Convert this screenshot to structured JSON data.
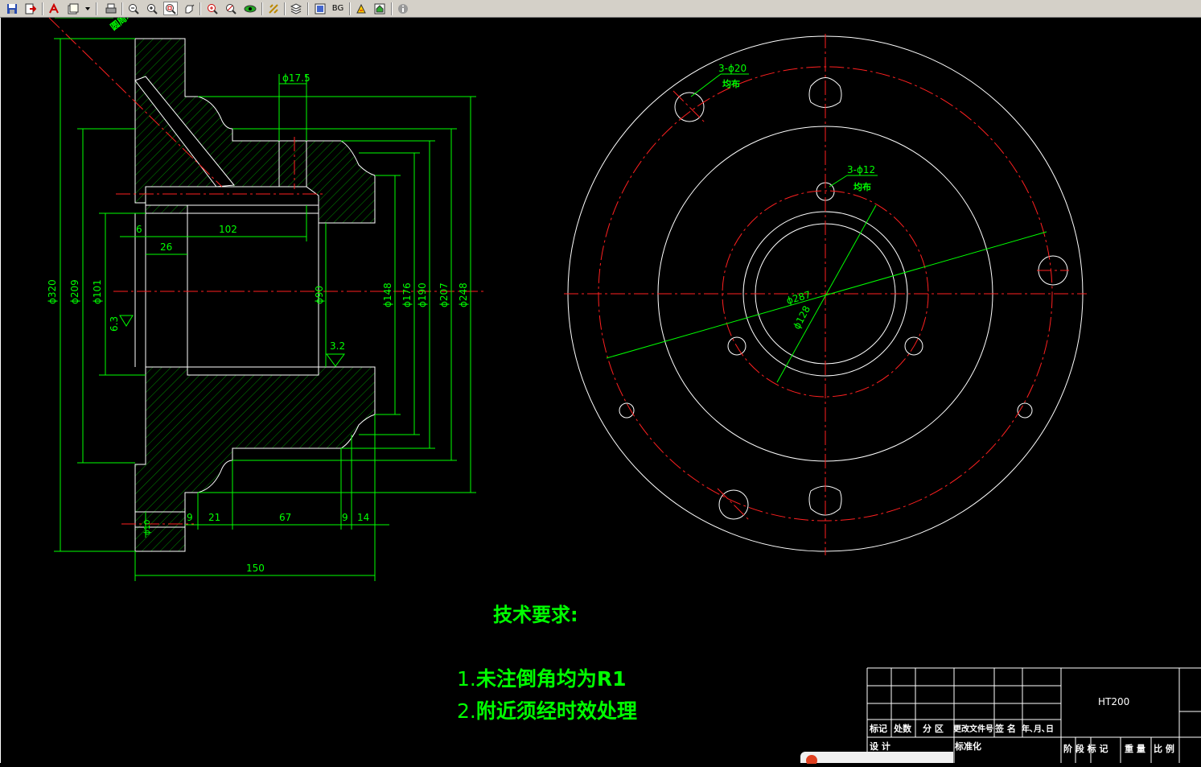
{
  "toolbar": {
    "buttons": [
      {
        "name": "save-icon",
        "glyph": "▣"
      },
      {
        "name": "export-icon",
        "glyph": "⇥"
      },
      {
        "name": "pdf-icon",
        "glyph": "✂"
      },
      {
        "name": "print-setup-icon",
        "glyph": "▤"
      },
      {
        "name": "dropdown-icon",
        "glyph": "▾"
      },
      {
        "name": "print-icon",
        "glyph": "⎙"
      },
      {
        "name": "zoom-out-icon",
        "glyph": "⊖"
      },
      {
        "name": "zoom-in-icon",
        "glyph": "⊕"
      },
      {
        "name": "zoom-window-icon",
        "glyph": "⊡"
      },
      {
        "name": "pan-icon",
        "glyph": "✋"
      },
      {
        "name": "zoom-extents-icon",
        "glyph": "⊕"
      },
      {
        "name": "zoom-previous-icon",
        "glyph": "⊘"
      },
      {
        "name": "view-icon",
        "glyph": "◉"
      },
      {
        "name": "measure-icon",
        "glyph": "↯"
      },
      {
        "name": "layers-icon",
        "glyph": "≋"
      },
      {
        "name": "frame-icon",
        "glyph": "▣"
      },
      {
        "name": "text-icon",
        "glyph": "A"
      },
      {
        "name": "home-icon",
        "glyph": "⌂"
      },
      {
        "name": "info-icon",
        "glyph": "ⓘ"
      }
    ],
    "bg_label": "BG"
  },
  "drawing": {
    "colors": {
      "dim": "#00ff00",
      "outline": "#ffffff",
      "center": "#ff2020",
      "hatch": "#00c000"
    },
    "left_view": {
      "dims_vertical": [
        "ϕ320",
        "ϕ209",
        "ϕ101",
        "6.3",
        "ϕ90",
        "ϕ148",
        "ϕ176",
        "ϕ190",
        "ϕ207",
        "ϕ248"
      ],
      "dims_horizontal": [
        "ϕ17.5",
        "6",
        "102",
        "26",
        "9",
        "21",
        "67",
        "9",
        "14",
        "150"
      ],
      "roughness": "3.2",
      "small_dim": "ϕ10",
      "diag_note": "圆周均布"
    },
    "right_view": {
      "holes_large": "3-ϕ20",
      "holes_large_note": "均布",
      "holes_small": "3-ϕ12",
      "holes_small_note": "均布",
      "dia1": "ϕ287",
      "dia2": "ϕ128"
    }
  },
  "tech_requirements": {
    "title": "技术要求:",
    "items": [
      {
        "num": "1.",
        "text": "未注倒角均为R1"
      },
      {
        "num": "2.",
        "text": "附近须经时效处理"
      }
    ]
  },
  "title_block": {
    "material": "HT200",
    "headers": [
      "标记",
      "处数",
      "分 区",
      "更改文件号",
      "签 名",
      "年､月､日"
    ],
    "row_labels": [
      "设 计",
      "标准化"
    ],
    "right_labels": [
      "阶 段 标 记",
      "重 量",
      "比 例"
    ]
  }
}
